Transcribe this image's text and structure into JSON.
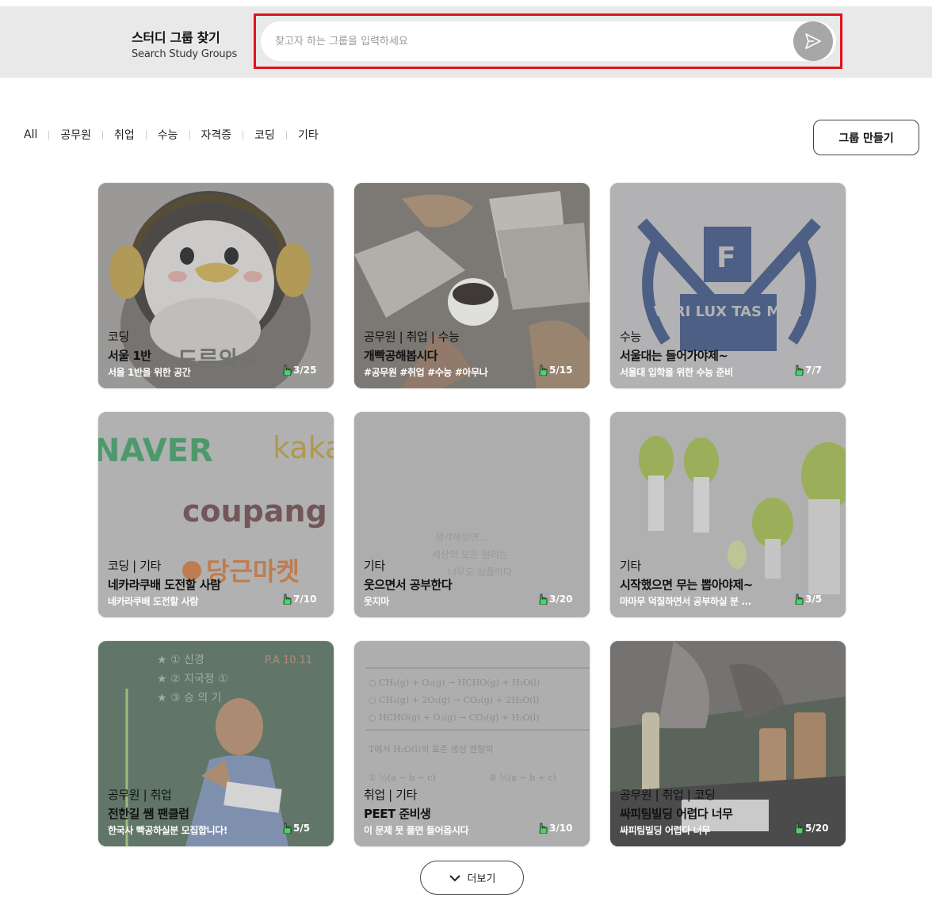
{
  "header": {
    "title_ko": "스터디 그룹 찾기",
    "title_en": "Search Study Groups",
    "search_placeholder": "찾고자 하는 그룹을 입력하세요",
    "search_value": ""
  },
  "filters": [
    "All",
    "공무원",
    "취업",
    "수능",
    "자격증",
    "코딩",
    "기타"
  ],
  "create_button": "그룹 만들기",
  "cards": [
    {
      "categories": "코딩",
      "title": "서울 1반",
      "description": "서울 1반을 위한 공간",
      "members": "3/25",
      "image_text": "드루와~",
      "image": "penguin-mascot-photo"
    },
    {
      "categories": "공무원 | 취업 | 수능",
      "title": "개빡공해봅시다",
      "description": "#공무원 #취업 #수능 #아무나",
      "members": "5/15",
      "image_text": "",
      "image": "study-desk-photo"
    },
    {
      "categories": "수능",
      "title": "서울대는 들어가야제~",
      "description": "서울대 입학을 위한 수능 준비",
      "members": "7/7",
      "image_text": "VERI LUX TAS MEA",
      "image": "university-emblem"
    },
    {
      "categories": "코딩 | 기타",
      "title": "네카라쿠배 도전할 사람",
      "description": "네카라쿠배 도전할 사람",
      "members": "7/10",
      "image_text": "NAVER kaka coupang 당근마켓",
      "image": "company-logos"
    },
    {
      "categories": "기타",
      "title": "웃으면서 공부한다",
      "description": "웃지마",
      "members": "3/20",
      "image_text": "생각해보면... 세상의 모든 원리는 너무도 심플하다",
      "image": "handwritten-note"
    },
    {
      "categories": "기타",
      "title": "시작했으면 무는 뽑아야제~",
      "description": "마마무 덕질하면서 공부하실 분 ...",
      "members": "3/5",
      "image_text": "",
      "image": "radish-lightsticks-photo"
    },
    {
      "categories": "공무원 | 취업",
      "title": "전한길 쌤 팬클럽",
      "description": "한국사 빡공하실분 모집합니다!",
      "members": "5/5",
      "image_text": "",
      "image": "lecturer-photo"
    },
    {
      "categories": "취업 | 기타",
      "title": "PEET 준비생",
      "description": "이 문제 못 풀면 들어옵시다",
      "members": "3/10",
      "image_text": "",
      "image": "chemistry-problem-sheet"
    },
    {
      "categories": "공무원 | 취업 | 코딩",
      "title": "싸피팀빌딩 어렵다 너무",
      "description": "싸피팀빌딩 어렵다 너무",
      "members": "5/20",
      "image_text": "",
      "image": "outdoor-study-photo"
    }
  ],
  "more_button": "더보기",
  "colors": {
    "header_bg": "#e9e9ea",
    "highlight_outline": "#e3121b",
    "send_button": "#a7a7a7",
    "member_icon": "#4ad36a"
  }
}
